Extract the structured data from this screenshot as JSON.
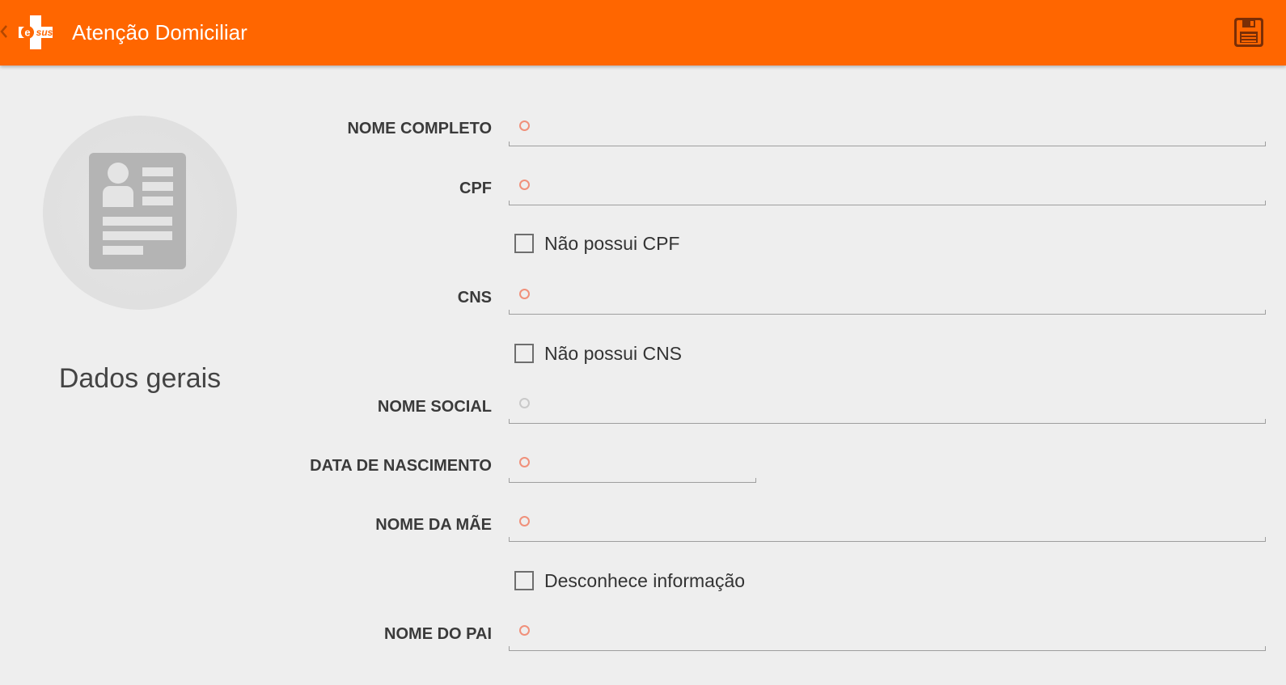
{
  "header": {
    "title": "Atenção Domiciliar",
    "logo_text": "esus",
    "bar_color": "#ff6600",
    "back_icon": "chevron-left-icon",
    "save_icon": "floppy-disk-icon"
  },
  "sidebar": {
    "section_title": "Dados gerais",
    "avatar_icon": "id-card-icon"
  },
  "form": {
    "nome_completo": {
      "label": "NOME COMPLETO",
      "value": ""
    },
    "cpf": {
      "label": "CPF",
      "value": ""
    },
    "nao_possui_cpf": {
      "label": "Não possui CPF",
      "checked": false
    },
    "cns": {
      "label": "CNS",
      "value": ""
    },
    "nao_possui_cns": {
      "label": "Não possui CNS",
      "checked": false
    },
    "nome_social": {
      "label": "NOME SOCIAL",
      "value": ""
    },
    "data_nascimento": {
      "label": "DATA DE NASCIMENTO",
      "value": ""
    },
    "nome_mae": {
      "label": "NOME DA MÃE",
      "value": ""
    },
    "desconhece_informacao": {
      "label": "Desconhece informação",
      "checked": false
    },
    "nome_pai": {
      "label": "NOME DO PAI",
      "value": ""
    }
  },
  "colors": {
    "required_marker": "#f0907a",
    "optional_marker": "#c9c9c9",
    "background": "#eeeeee"
  }
}
